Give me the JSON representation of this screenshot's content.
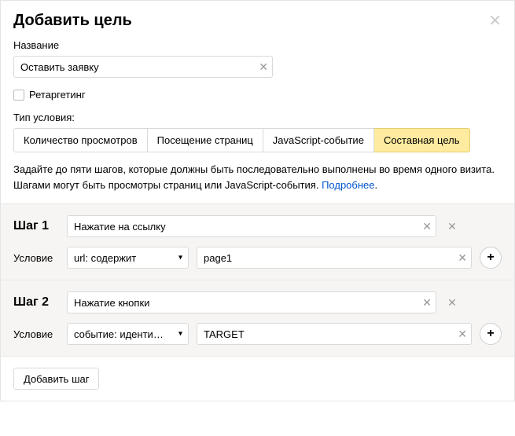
{
  "header": {
    "title": "Добавить цель"
  },
  "name": {
    "label": "Название",
    "value": "Оставить заявку"
  },
  "retargeting": {
    "label": "Ретаргетинг",
    "checked": false
  },
  "condition_type": {
    "label": "Тип условия:",
    "tabs": [
      {
        "label": "Количество просмотров",
        "active": false
      },
      {
        "label": "Посещение страниц",
        "active": false
      },
      {
        "label": "JavaScript-событие",
        "active": false
      },
      {
        "label": "Составная цель",
        "active": true
      }
    ]
  },
  "description": {
    "text": "Задайте до пяти шагов, которые должны быть последовательно выполнены во время одного визита. Шагами могут быть просмотры страниц или JavaScript-события. ",
    "link": "Подробнее",
    "suffix": "."
  },
  "steps": [
    {
      "title": "Шаг 1",
      "name": "Нажатие на ссылку",
      "condition_label": "Условие",
      "condition_type": "url: содержит",
      "condition_value": "page1"
    },
    {
      "title": "Шаг 2",
      "name": "Нажатие кнопки",
      "condition_label": "Условие",
      "condition_type": "событие: идентифи...",
      "condition_value": "TARGET"
    }
  ],
  "footer": {
    "add_step": "Добавить шаг"
  }
}
